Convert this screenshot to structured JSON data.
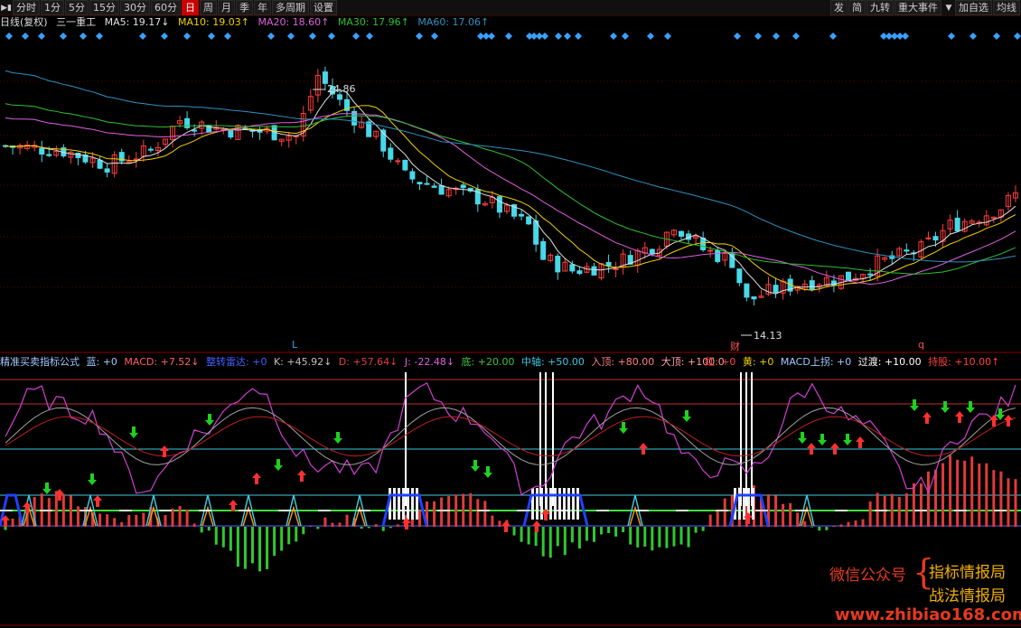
{
  "toolbar": {
    "left_items": [
      "分时",
      "1分",
      "5分",
      "15分",
      "30分",
      "60分",
      "日",
      "周",
      "月",
      "季",
      "年",
      "多周期",
      "设置"
    ],
    "active_item": "日",
    "right_items": [
      "发",
      "简",
      "九转",
      "重大事件",
      "加自选",
      "均线"
    ]
  },
  "main_legend": {
    "period": "日线(复权)",
    "stock": "三一重工",
    "ma5": "MA5: 19.17↓",
    "ma10": "MA10: 19.03↑",
    "ma20": "MA20: 18.60↑",
    "ma30": "MA30: 17.96↑",
    "ma60": "MA60: 17.06↑"
  },
  "colors": {
    "up": "#ff3c3c",
    "down": "#48d8e8",
    "ma5": "#e0e0e0",
    "ma10": "#f0d000",
    "ma20": "#e060e0",
    "ma30": "#30c030",
    "ma60": "#3090c0",
    "grid": "#5a0000"
  },
  "price_labels": {
    "high": "24.86",
    "low": "14.13"
  },
  "markers": {
    "l": "L",
    "cai": "财",
    "q": "q"
  },
  "indicator_legend": {
    "name": "精准买卖指标公式",
    "lan": "蓝: +0",
    "macd": "MACD: +7.52↓",
    "zhuan": "整转雷达: +0",
    "k": "K: +45.92↓",
    "d": "D: +57.64↓",
    "j": "J: -22.48↓",
    "di": "底: +20.00",
    "zhongzhou": "中轴: +50.00",
    "ruding": "入顶: +80.00",
    "dading": "大顶: +100.0",
    "hong": "红: +0",
    "huang": "黄: +0",
    "macd_up": "MACD上拐: +0",
    "guodu": "过渡: +10.00",
    "chigu": "持股: +10.00↑"
  },
  "watermark": {
    "wechat": "微信公众号",
    "brand1": "指标情报局",
    "brand2": "战法情报局",
    "url": "www.zhibiao168.com"
  }
}
